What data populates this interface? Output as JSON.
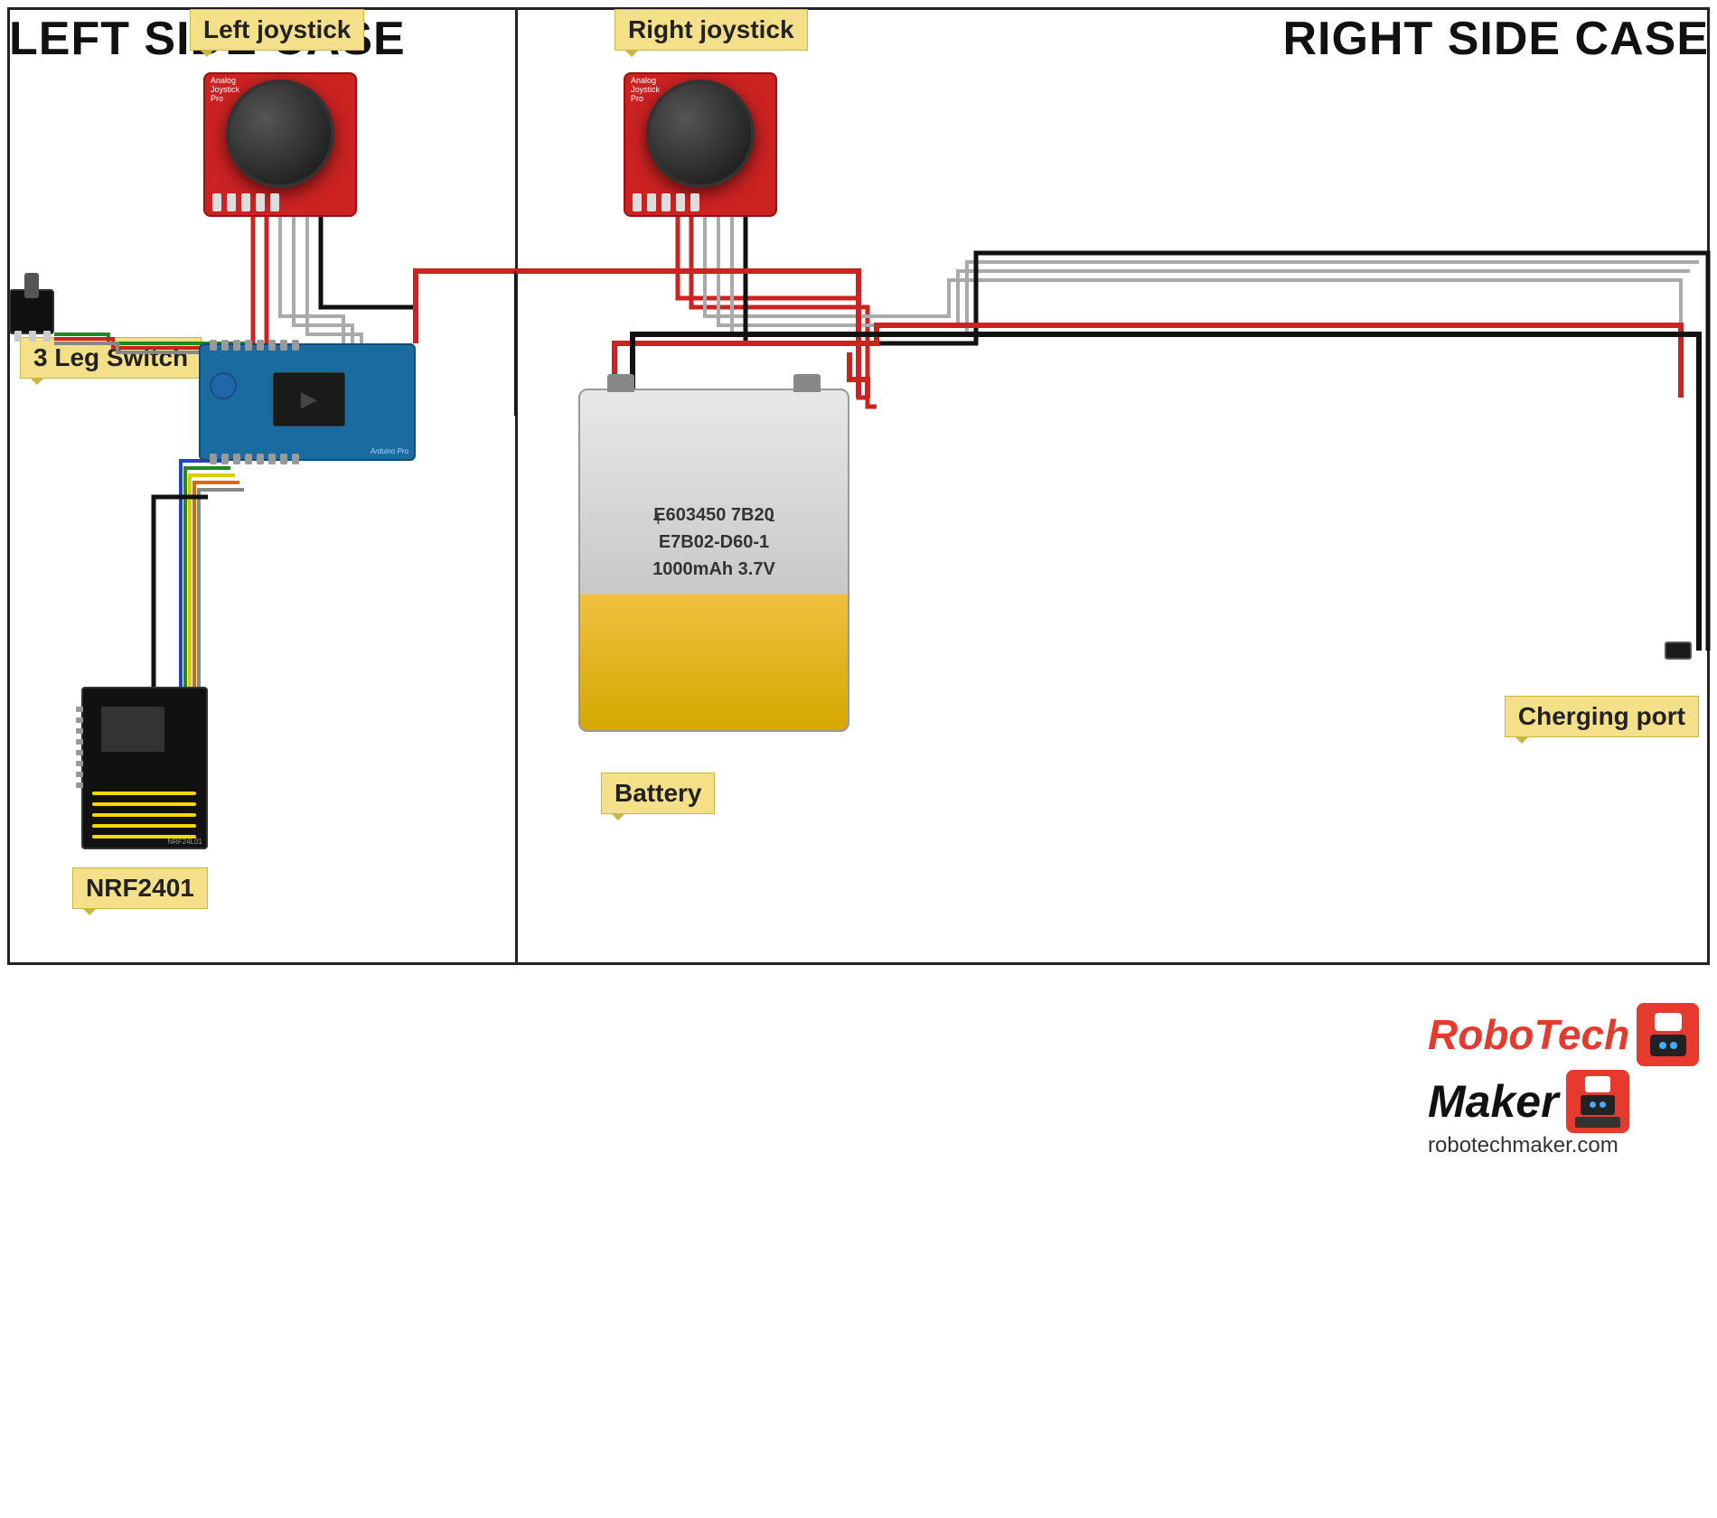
{
  "labels": {
    "left_case": "LEFT SIDE CASE",
    "right_case": "RIGHT SIDE CASE",
    "left_joystick": "Left joystick",
    "right_joystick": "Right joystick",
    "three_leg_switch": "3 Leg Switch",
    "battery": "Battery",
    "nrf": "NRF2401",
    "charging_port": "Cherging port",
    "logo_robotech": "RoboTech",
    "logo_maker": "Maker",
    "logo_url": "robotechmaker.com"
  },
  "battery": {
    "line1": "E603450 7B20",
    "line2": "E7B02-D60-1",
    "line3": "1000mAh 3.7V",
    "plus": "+",
    "minus": "-"
  },
  "joystick": {
    "label": "Analog\nJoystick"
  }
}
